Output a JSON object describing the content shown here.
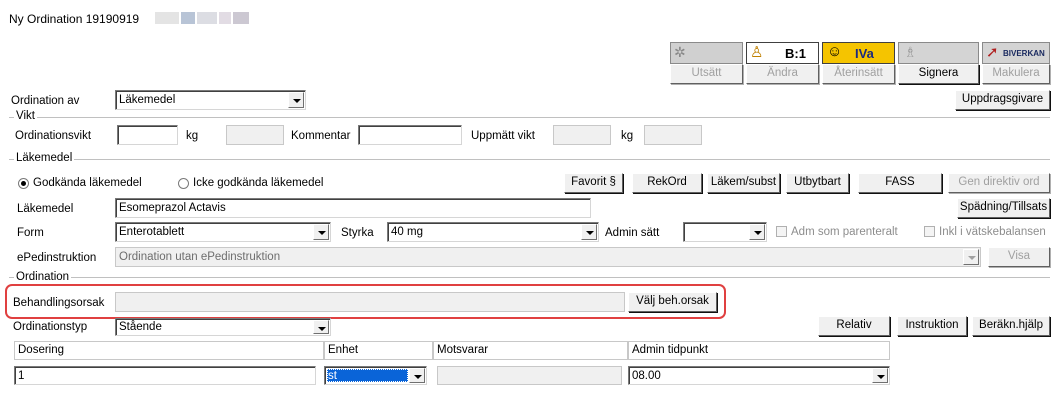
{
  "window": {
    "title": "Ny Ordination 19190919"
  },
  "toolbar": {
    "badge_b": "B:1",
    "badge_iva": "IVa",
    "badge_biverkan": "BIVERKAN",
    "buttons": {
      "utsatt": "Utsätt",
      "andra": "Ändra",
      "aterinsatt": "Återinsätt",
      "signera": "Signera",
      "makulera": "Makulera"
    }
  },
  "ordination_av": {
    "label": "Ordination av",
    "value": "Läkemedel"
  },
  "uppdragsgivare_button": "Uppdragsgivare",
  "vikt": {
    "title": "Vikt",
    "ordinationsvikt_label": "Ordinationsvikt",
    "ordinationsvikt_value": "",
    "kg1": "kg",
    "kommentar_label": "Kommentar",
    "kommentar_value": "",
    "uppmatt_label": "Uppmätt vikt",
    "kg2": "kg"
  },
  "lakemedel": {
    "title": "Läkemedel",
    "radio_godkanda": "Godkända läkemedel",
    "radio_icke": "Icke godkända läkemedel",
    "buttons": {
      "favorit": "Favorit §",
      "rekord": "RekOrd",
      "lakem_subst": "Läkem/subst",
      "utbytbart": "Utbytbart",
      "fass": "FASS",
      "gen_direktiv": "Gen direktiv ord"
    },
    "lakemedel_label": "Läkemedel",
    "lakemedel_value": "Esomeprazol Actavis",
    "spadning_button": "Spädning/Tillsats",
    "form_label": "Form",
    "form_value": "Enterotablett",
    "styrka_label": "Styrka",
    "styrka_value": "40 mg",
    "admin_satt_label": "Admin sätt",
    "admin_satt_value": "",
    "adm_parenteralt": "Adm som parenteralt",
    "inkl_vatske": "Inkl i vätskebalansen",
    "epedinstruktion_label": "ePedinstruktion",
    "epedinstruktion_value": "Ordination utan ePedinstruktion",
    "visa_button": "Visa"
  },
  "ordination": {
    "title": "Ordination",
    "behandlingsorsak_label": "Behandlingsorsak",
    "behandlingsorsak_value": "",
    "valj_button": "Välj beh.orsak",
    "ordinationstyp_label": "Ordinationstyp",
    "ordinationstyp_value": "Stående",
    "relativ_button": "Relativ",
    "instruktion_button": "Instruktion",
    "berakn_button": "Beräkn.hjälp",
    "columns": {
      "dosering": "Dosering",
      "enhet": "Enhet",
      "motsvarar": "Motsvarar",
      "admin_tidpunkt": "Admin tidpunkt"
    },
    "row": {
      "dosering": "1",
      "enhet": "st",
      "motsvarar": "",
      "admin_tidpunkt": "08.00"
    }
  },
  "colors": {
    "highlight": "#e04040",
    "iva_yellow": "#f5c400",
    "selection_blue": "#0a64d8"
  }
}
